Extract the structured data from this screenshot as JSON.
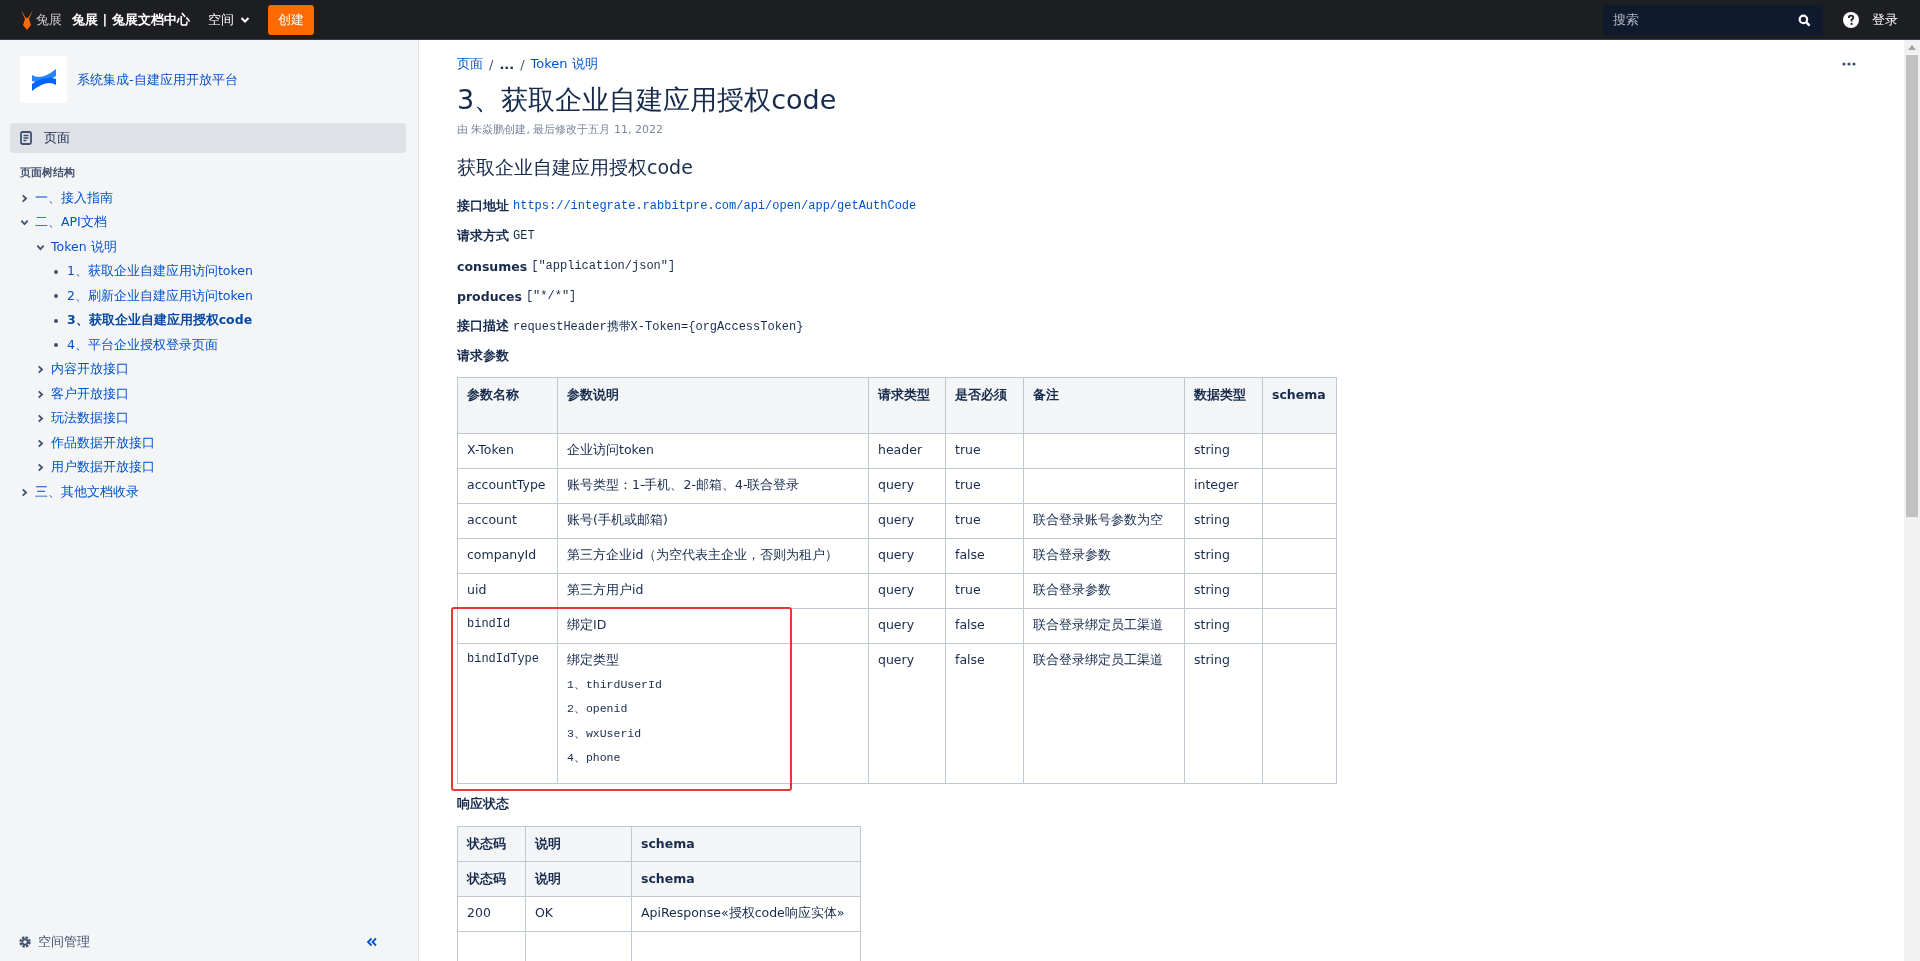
{
  "topbar": {
    "brand": "兔展",
    "site_title": "兔展 | 兔展文档中心",
    "space_menu": "空间",
    "create_button": "创建",
    "search": {
      "placeholder": "搜索"
    },
    "login": "登录"
  },
  "sidebar": {
    "space_name": "系统集成-自建应用开放平台",
    "pages_item": {
      "label": "页面",
      "selected": true
    },
    "tree_heading": "页面树结构",
    "tree": [
      {
        "label": "一、接入指南",
        "kind": "folder",
        "expanded": false,
        "selected": false
      },
      {
        "label": "二、API文档",
        "kind": "folder",
        "expanded": true,
        "selected": false,
        "children": [
          {
            "label": "Token 说明",
            "kind": "folder",
            "expanded": true,
            "selected": false,
            "children": [
              {
                "label": "1、获取企业自建应用访问token",
                "kind": "page",
                "selected": false
              },
              {
                "label": "2、刷新企业自建应用访问token",
                "kind": "page",
                "selected": false
              },
              {
                "label": "3、获取企业自建应用授权code",
                "kind": "page",
                "selected": true
              },
              {
                "label": "4、平台企业授权登录页面",
                "kind": "page",
                "selected": false
              }
            ]
          },
          {
            "label": "内容开放接口",
            "kind": "folder",
            "expanded": false,
            "selected": false
          },
          {
            "label": "客户开放接口",
            "kind": "folder",
            "expanded": false,
            "selected": false
          },
          {
            "label": "玩法数据接口",
            "kind": "folder",
            "expanded": false,
            "selected": false
          },
          {
            "label": "作品数据开放接口",
            "kind": "folder",
            "expanded": false,
            "selected": false
          },
          {
            "label": "用户数据开放接口",
            "kind": "folder",
            "expanded": false,
            "selected": false
          }
        ]
      },
      {
        "label": "三、其他文档收录",
        "kind": "folder",
        "expanded": false,
        "selected": false
      }
    ],
    "footer": "空间管理"
  },
  "breadcrumb": {
    "separator": "/",
    "items": [
      "页面",
      "...",
      "Token 说明"
    ]
  },
  "page": {
    "title": "3、获取企业自建应用授权code",
    "byline": "由 朱焱鹏创建, 最后修改于五月 11, 2022",
    "heading": "获取企业自建应用授权code",
    "fields": [
      {
        "label": "接口地址",
        "value": "https://integrate.rabbitpre.com/api/open/app/getAuthCode",
        "kind": "link"
      },
      {
        "label": "请求方式",
        "value": "GET",
        "kind": "code"
      },
      {
        "label": "consumes",
        "value": "[\"application/json\"]",
        "kind": "code"
      },
      {
        "label": "produces",
        "value": "[\"*/*\"]",
        "kind": "code"
      },
      {
        "label": "接口描述",
        "value": "requestHeader携带X-Token={orgAccessToken}",
        "kind": "code"
      }
    ],
    "params_heading": "请求参数",
    "params_table": {
      "columns": [
        "参数名称",
        "参数说明",
        "请求类型",
        "是否必须",
        "备注",
        "数据类型",
        "schema"
      ],
      "rows": [
        {
          "name": "X-Token",
          "monospace": false,
          "description": "企业访问token",
          "in": "header",
          "required": "true",
          "type": "string"
        },
        {
          "name": "accountType",
          "monospace": false,
          "description": "账号类型：1-手机、2-邮箱、4-联合登录",
          "in": "query",
          "required": "true",
          "type": "integer"
        },
        {
          "name": "account",
          "monospace": false,
          "description": "账号(手机或邮箱)",
          "in": "query",
          "required": "true",
          "note": "联合登录账号参数为空",
          "type": "string"
        },
        {
          "name": "companyId",
          "monospace": false,
          "description": "第三方企业id（为空代表主企业，否则为租户）",
          "in": "query",
          "required": "false",
          "note": "联合登录参数",
          "type": "string"
        },
        {
          "name": "uid",
          "monospace": false,
          "description": "第三方用户id",
          "in": "query",
          "required": "true",
          "note": "联合登录参数",
          "type": "string"
        },
        {
          "name": "bindId",
          "monospace": true,
          "description": "绑定ID",
          "in": "query",
          "required": "false",
          "note": "联合登录绑定员工渠道",
          "type": "string"
        },
        {
          "name": "bindIdType",
          "monospace": true,
          "description": "绑定类型",
          "options": [
            "1、thirdUserId",
            "2、openid",
            "3、wxUserid",
            "4、phone"
          ],
          "in": "query",
          "required": "false",
          "note": "联合登录绑定员工渠道",
          "type": "string"
        }
      ],
      "annotation": {
        "kind": "rectangle"
      }
    },
    "response_heading": "响应状态",
    "response_table": {
      "columns": [
        "状态码",
        "说明",
        "schema"
      ],
      "header_rows": [
        [
          "状态码",
          "说明",
          "schema"
        ]
      ],
      "rows": [
        [
          "200",
          "OK",
          "ApiResponse«授权code响应实体»"
        ]
      ]
    }
  }
}
